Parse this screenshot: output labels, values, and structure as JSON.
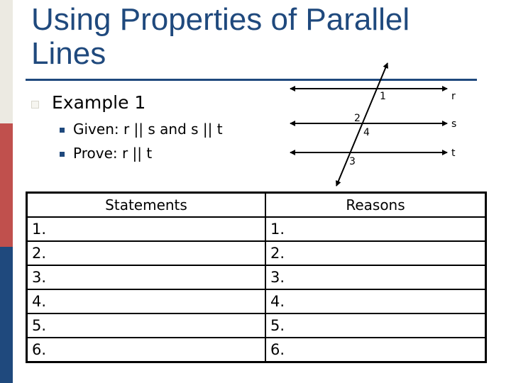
{
  "slide": {
    "title": "Using Properties of Parallel Lines",
    "colors": {
      "title": "#1F497D",
      "sidebar_top": "#ECEAE2",
      "sidebar_mid": "#C0504D",
      "sidebar_bottom": "#1F497D"
    }
  },
  "content": {
    "heading": "Example 1",
    "bullets": [
      "Given: r || s and s || t",
      "Prove: r || t"
    ]
  },
  "diagram": {
    "line_labels": [
      "r",
      "s",
      "t"
    ],
    "angle_labels": [
      "1",
      "2",
      "4",
      "3"
    ]
  },
  "proof_table": {
    "headers": [
      "Statements",
      "Reasons"
    ],
    "rows": [
      [
        "1.",
        "1."
      ],
      [
        "2.",
        "2."
      ],
      [
        "3.",
        "3."
      ],
      [
        "4.",
        "4."
      ],
      [
        "5.",
        "5."
      ],
      [
        "6.",
        "6."
      ]
    ]
  }
}
